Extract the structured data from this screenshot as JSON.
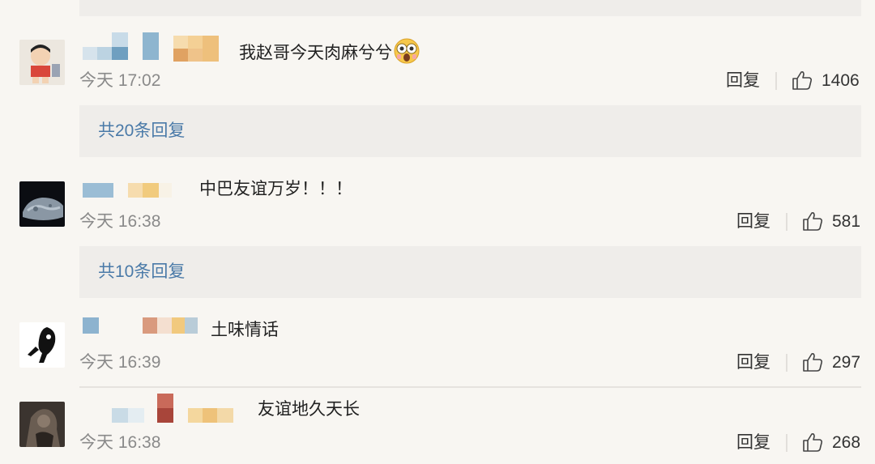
{
  "comments": [
    {
      "text": "我赵哥今天肉麻兮兮",
      "time": "今天 17:02",
      "reply_label": "回复",
      "likes": "1406",
      "more_replies": "共20条回复",
      "emoji": "shocked-face-emoji"
    },
    {
      "text": "中巴友谊万岁！！！",
      "time": "今天 16:38",
      "reply_label": "回复",
      "likes": "581",
      "more_replies": "共10条回复"
    },
    {
      "text": "土味情话",
      "time": "今天 16:39",
      "reply_label": "回复",
      "likes": "297"
    },
    {
      "text": "友谊地久天长",
      "time": "今天 16:38",
      "reply_label": "回复",
      "likes": "268"
    }
  ],
  "colors": {
    "background": "#f8f6f2",
    "reply_box": "#efedea",
    "link": "#4a7aa8"
  }
}
